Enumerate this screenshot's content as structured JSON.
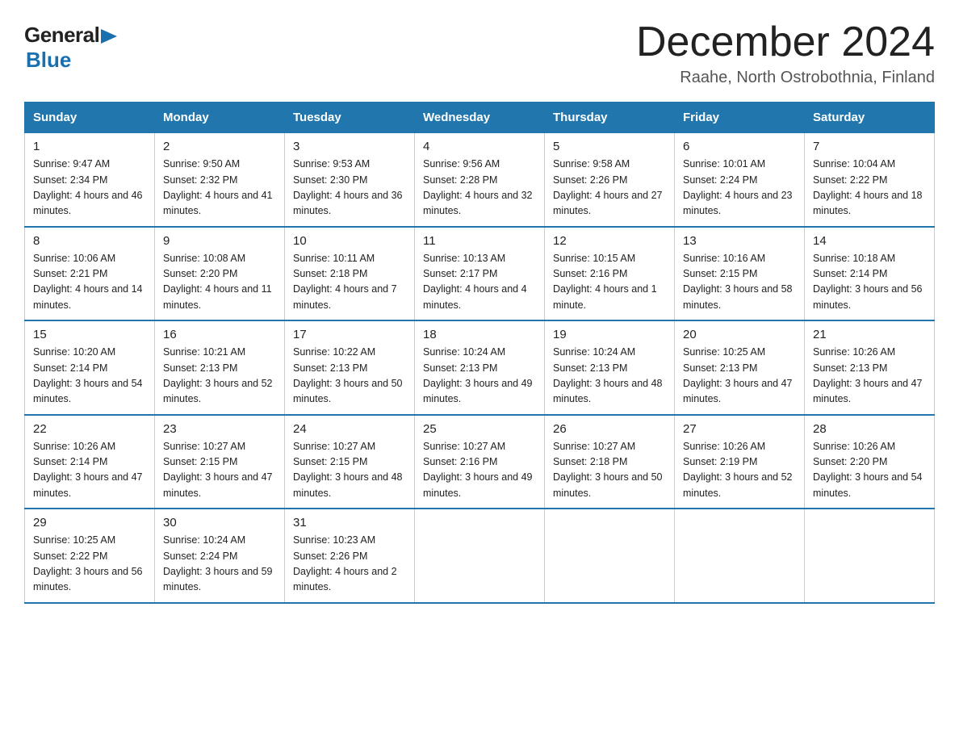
{
  "header": {
    "logo": {
      "general": "General",
      "blue": "Blue",
      "arrow_color": "#1a6faf"
    },
    "title": "December 2024",
    "location": "Raahe, North Ostrobothnia, Finland"
  },
  "calendar": {
    "weekdays": [
      "Sunday",
      "Monday",
      "Tuesday",
      "Wednesday",
      "Thursday",
      "Friday",
      "Saturday"
    ],
    "weeks": [
      [
        {
          "day": "1",
          "sunrise": "9:47 AM",
          "sunset": "2:34 PM",
          "daylight": "4 hours and 46 minutes."
        },
        {
          "day": "2",
          "sunrise": "9:50 AM",
          "sunset": "2:32 PM",
          "daylight": "4 hours and 41 minutes."
        },
        {
          "day": "3",
          "sunrise": "9:53 AM",
          "sunset": "2:30 PM",
          "daylight": "4 hours and 36 minutes."
        },
        {
          "day": "4",
          "sunrise": "9:56 AM",
          "sunset": "2:28 PM",
          "daylight": "4 hours and 32 minutes."
        },
        {
          "day": "5",
          "sunrise": "9:58 AM",
          "sunset": "2:26 PM",
          "daylight": "4 hours and 27 minutes."
        },
        {
          "day": "6",
          "sunrise": "10:01 AM",
          "sunset": "2:24 PM",
          "daylight": "4 hours and 23 minutes."
        },
        {
          "day": "7",
          "sunrise": "10:04 AM",
          "sunset": "2:22 PM",
          "daylight": "4 hours and 18 minutes."
        }
      ],
      [
        {
          "day": "8",
          "sunrise": "10:06 AM",
          "sunset": "2:21 PM",
          "daylight": "4 hours and 14 minutes."
        },
        {
          "day": "9",
          "sunrise": "10:08 AM",
          "sunset": "2:20 PM",
          "daylight": "4 hours and 11 minutes."
        },
        {
          "day": "10",
          "sunrise": "10:11 AM",
          "sunset": "2:18 PM",
          "daylight": "4 hours and 7 minutes."
        },
        {
          "day": "11",
          "sunrise": "10:13 AM",
          "sunset": "2:17 PM",
          "daylight": "4 hours and 4 minutes."
        },
        {
          "day": "12",
          "sunrise": "10:15 AM",
          "sunset": "2:16 PM",
          "daylight": "4 hours and 1 minute."
        },
        {
          "day": "13",
          "sunrise": "10:16 AM",
          "sunset": "2:15 PM",
          "daylight": "3 hours and 58 minutes."
        },
        {
          "day": "14",
          "sunrise": "10:18 AM",
          "sunset": "2:14 PM",
          "daylight": "3 hours and 56 minutes."
        }
      ],
      [
        {
          "day": "15",
          "sunrise": "10:20 AM",
          "sunset": "2:14 PM",
          "daylight": "3 hours and 54 minutes."
        },
        {
          "day": "16",
          "sunrise": "10:21 AM",
          "sunset": "2:13 PM",
          "daylight": "3 hours and 52 minutes."
        },
        {
          "day": "17",
          "sunrise": "10:22 AM",
          "sunset": "2:13 PM",
          "daylight": "3 hours and 50 minutes."
        },
        {
          "day": "18",
          "sunrise": "10:24 AM",
          "sunset": "2:13 PM",
          "daylight": "3 hours and 49 minutes."
        },
        {
          "day": "19",
          "sunrise": "10:24 AM",
          "sunset": "2:13 PM",
          "daylight": "3 hours and 48 minutes."
        },
        {
          "day": "20",
          "sunrise": "10:25 AM",
          "sunset": "2:13 PM",
          "daylight": "3 hours and 47 minutes."
        },
        {
          "day": "21",
          "sunrise": "10:26 AM",
          "sunset": "2:13 PM",
          "daylight": "3 hours and 47 minutes."
        }
      ],
      [
        {
          "day": "22",
          "sunrise": "10:26 AM",
          "sunset": "2:14 PM",
          "daylight": "3 hours and 47 minutes."
        },
        {
          "day": "23",
          "sunrise": "10:27 AM",
          "sunset": "2:15 PM",
          "daylight": "3 hours and 47 minutes."
        },
        {
          "day": "24",
          "sunrise": "10:27 AM",
          "sunset": "2:15 PM",
          "daylight": "3 hours and 48 minutes."
        },
        {
          "day": "25",
          "sunrise": "10:27 AM",
          "sunset": "2:16 PM",
          "daylight": "3 hours and 49 minutes."
        },
        {
          "day": "26",
          "sunrise": "10:27 AM",
          "sunset": "2:18 PM",
          "daylight": "3 hours and 50 minutes."
        },
        {
          "day": "27",
          "sunrise": "10:26 AM",
          "sunset": "2:19 PM",
          "daylight": "3 hours and 52 minutes."
        },
        {
          "day": "28",
          "sunrise": "10:26 AM",
          "sunset": "2:20 PM",
          "daylight": "3 hours and 54 minutes."
        }
      ],
      [
        {
          "day": "29",
          "sunrise": "10:25 AM",
          "sunset": "2:22 PM",
          "daylight": "3 hours and 56 minutes."
        },
        {
          "day": "30",
          "sunrise": "10:24 AM",
          "sunset": "2:24 PM",
          "daylight": "3 hours and 59 minutes."
        },
        {
          "day": "31",
          "sunrise": "10:23 AM",
          "sunset": "2:26 PM",
          "daylight": "4 hours and 2 minutes."
        },
        null,
        null,
        null,
        null
      ]
    ]
  }
}
